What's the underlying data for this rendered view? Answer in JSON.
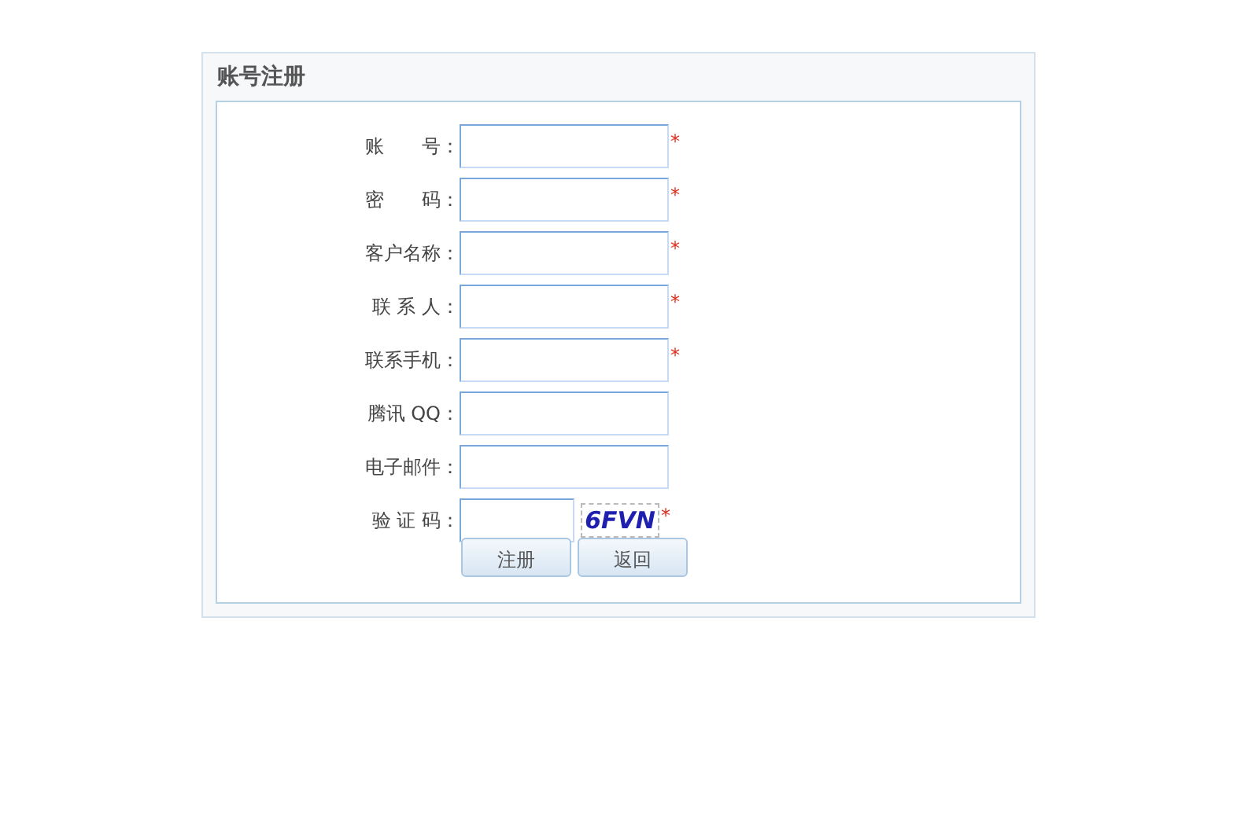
{
  "title": "账号注册",
  "fields": [
    {
      "label": "账　　号：",
      "required": true,
      "kind": "text"
    },
    {
      "label": "密　　码：",
      "required": true,
      "kind": "text"
    },
    {
      "label": "客户名称：",
      "required": true,
      "kind": "text"
    },
    {
      "label": "联 系 人：",
      "required": true,
      "kind": "text"
    },
    {
      "label": "联系手机：",
      "required": true,
      "kind": "text"
    },
    {
      "label": "腾讯 QQ：",
      "required": false,
      "kind": "text"
    },
    {
      "label": "电子邮件：",
      "required": false,
      "kind": "text"
    },
    {
      "label": "验 证 码：",
      "required": true,
      "kind": "captcha",
      "captcha": "6FVN"
    }
  ],
  "required_mark": "*",
  "buttons": [
    "注册",
    "返回"
  ]
}
